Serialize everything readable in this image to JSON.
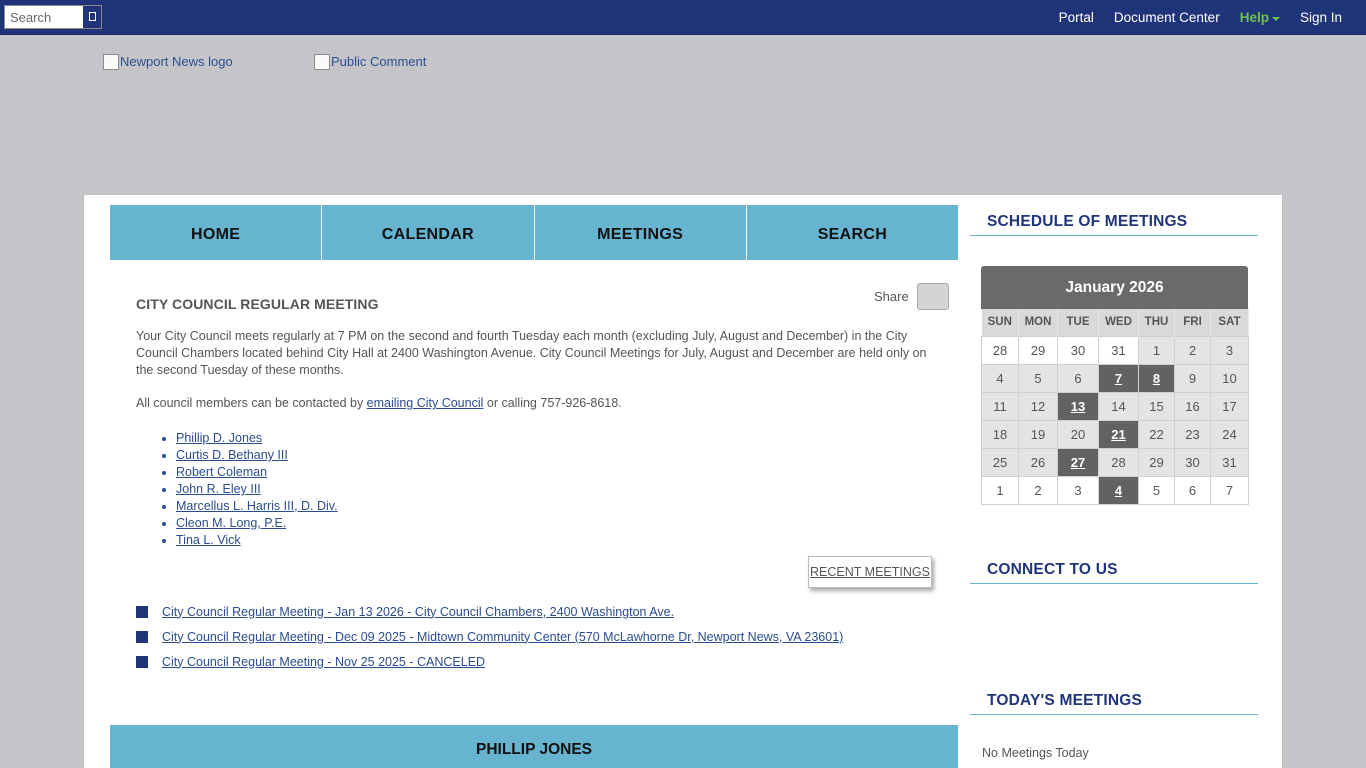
{
  "topbar": {
    "search_placeholder": "Search",
    "nav": [
      "Portal",
      "Document Center",
      "Help",
      "Sign In"
    ]
  },
  "header": {
    "logo_alt": "Newport News logo",
    "public_comment_alt": "Public Comment"
  },
  "main_nav": [
    "HOME",
    "CALENDAR",
    "MEETINGS",
    "SEARCH"
  ],
  "page": {
    "title": "CITY COUNCIL REGULAR MEETING",
    "share_label": "Share",
    "intro": "Your City Council meets regularly at 7 PM on the second and fourth Tuesday each month (excluding July, August and December) in the City Council Chambers located behind City Hall at 2400 Washington Avenue. City Council Meetings for July, August and December are held only on the second Tuesday of these months.",
    "contact_before": "All council members can be contacted by ",
    "contact_link": "emailing City Council",
    "contact_after": " or calling 757-926-8618.",
    "members": [
      "Phillip D. Jones",
      "Curtis D. Bethany III",
      "Robert Coleman",
      "John R. Eley III",
      "Marcellus L. Harris III, D. Div.",
      "Cleon M. Long, P.E.",
      "Tina L. Vick"
    ],
    "recent_button": "RECENT MEETINGS",
    "meetings": [
      "City Council Regular Meeting - Jan 13 2026 - City Council Chambers, 2400 Washington Ave.",
      "City Council Regular Meeting - Dec 09 2025 - Midtown Community Center (570 McLawhorne Dr, Newport News, VA 23601)",
      "City Council Regular Meeting - Nov 25 2025 - CANCELED"
    ],
    "section_banner": "PHILLIP JONES"
  },
  "sidebar": {
    "schedule_heading": "SCHEDULE OF MEETINGS",
    "calendar": {
      "month": "January 2026",
      "days": [
        "SUN",
        "MON",
        "TUE",
        "WED",
        "THU",
        "FRI",
        "SAT"
      ],
      "weeks": [
        [
          "28",
          "29",
          "30",
          "31",
          "1",
          "2",
          "3"
        ],
        [
          "4",
          "5",
          "6",
          "7",
          "8",
          "9",
          "10"
        ],
        [
          "11",
          "12",
          "13",
          "14",
          "15",
          "16",
          "17"
        ],
        [
          "18",
          "19",
          "20",
          "21",
          "22",
          "23",
          "24"
        ],
        [
          "25",
          "26",
          "27",
          "28",
          "29",
          "30",
          "31"
        ],
        [
          "1",
          "2",
          "3",
          "4",
          "5",
          "6",
          "7"
        ]
      ],
      "meeting_days": [
        "7",
        "8",
        "13",
        "21",
        "27",
        "4 (Feb)"
      ]
    },
    "connect_heading": "CONNECT TO US",
    "today_heading": "TODAY'S MEETINGS",
    "today_text": "No Meetings Today"
  },
  "colors": {
    "topbar": "#20347a",
    "nav_tile": "#66b4d0",
    "help": "#6cc24a",
    "link": "#2a4d8f",
    "meeting_day": "#626262"
  }
}
